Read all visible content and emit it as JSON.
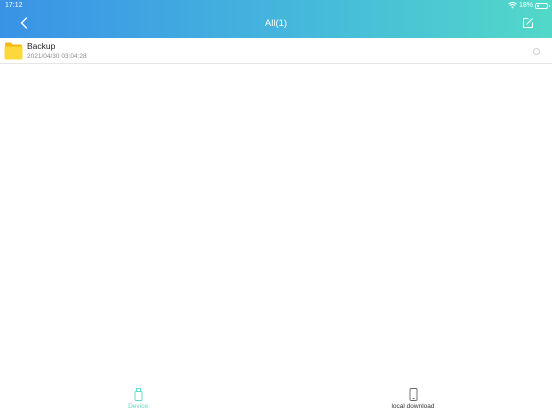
{
  "status_bar": {
    "time": "17:12",
    "battery_percent": "18%",
    "battery_level": 0.18
  },
  "header": {
    "title": "All(1)",
    "back_icon": "chevron-left-icon",
    "edit_icon": "edit-icon"
  },
  "files": [
    {
      "name": "Backup",
      "date": "2021/04/30 03:04:28",
      "icon": "folder-icon"
    }
  ],
  "tabs": [
    {
      "label": "Device",
      "icon": "usb-drive-icon",
      "active": true
    },
    {
      "label": "local download",
      "icon": "tablet-icon",
      "active": false
    }
  ],
  "colors": {
    "header_gradient_start": "#3a92e6",
    "header_gradient_end": "#52d8c8",
    "active_tab": "#5fd8c8",
    "inactive_tab": "#333333",
    "folder": "#f9c917"
  }
}
